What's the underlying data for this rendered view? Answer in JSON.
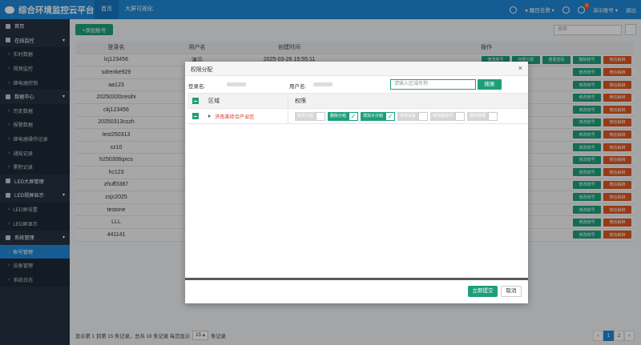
{
  "app": {
    "title": "综合环境监控云平台"
  },
  "topnav": [
    {
      "label": "首页"
    },
    {
      "label": "大屏可视化"
    }
  ],
  "topright": {
    "badge": "6",
    "lang": "醒目告警",
    "account": "演示账号",
    "logout": "退出"
  },
  "sidebar": {
    "items": [
      {
        "label": "首页",
        "type": "group"
      },
      {
        "label": "在线监控",
        "type": "group"
      },
      {
        "label": "实时数据",
        "type": "sub"
      },
      {
        "label": "视频监控",
        "type": "sub"
      },
      {
        "label": "继电器控制",
        "type": "sub"
      },
      {
        "label": "数据中心",
        "type": "group"
      },
      {
        "label": "历史数据",
        "type": "sub"
      },
      {
        "label": "报警数据",
        "type": "sub"
      },
      {
        "label": "继电器操作记录",
        "type": "sub"
      },
      {
        "label": "通知记录",
        "type": "sub"
      },
      {
        "label": "累积记录",
        "type": "sub"
      },
      {
        "label": "LED大屏管理",
        "type": "group"
      },
      {
        "label": "LED视屏显示",
        "type": "group"
      },
      {
        "label": "LED屏设置",
        "type": "sub"
      },
      {
        "label": "LED屏显示",
        "type": "sub"
      },
      {
        "label": "系统管理",
        "type": "group"
      },
      {
        "label": "账号管理",
        "type": "sub",
        "active": true
      },
      {
        "label": "设备管理",
        "type": "sub"
      },
      {
        "label": "系统日志",
        "type": "sub"
      }
    ]
  },
  "main": {
    "add_label": "+添加账号",
    "search_placeholder": "搜索",
    "table": {
      "headers": [
        "登录名",
        "用户名",
        "创建时间",
        "操作"
      ],
      "first_row_user": "演示",
      "first_row_time": "2025-03-26 15:55:11",
      "ops": [
        "修改账号",
        "权限分配",
        "重置密码",
        "删除账号",
        "微信解绑"
      ],
      "op_green": "修改账号",
      "op_orange": "微信解绑",
      "rows": [
        "lcj123456",
        "sdrenke929",
        "aa123",
        "20250320cesihi",
        "ckj123456",
        "20250313cszh",
        "test250313",
        "xz10",
        "h250306qxcs",
        "hc123",
        "zhuff3387",
        "zsjc2025",
        "testone",
        "LLL",
        "441141"
      ]
    },
    "footer": {
      "text": "显示第 1 到第 15 条记录，总共 18 条记录 每页显示",
      "page_size": "15",
      "suffix": "条记录",
      "pages": [
        "‹",
        "1",
        "2",
        "›"
      ]
    }
  },
  "modal": {
    "title": "权限分配",
    "close": "×",
    "login_label": "登录名:",
    "user_label": "用户名:",
    "area_placeholder": "请输入区域名称",
    "search_label": "搜索",
    "col_region": "区域",
    "col_perm": "权限",
    "region": "济南某综合产业区",
    "perms": [
      {
        "label": "修改分组",
        "on": false
      },
      {
        "label": "删除分组",
        "on": true
      },
      {
        "label": "增加子分组",
        "on": true
      },
      {
        "label": "修改设备",
        "on": false
      },
      {
        "label": "继电器操作",
        "on": false
      },
      {
        "label": "删除数据",
        "on": false
      }
    ],
    "submit": "立即提交",
    "cancel": "取消"
  },
  "colors": {
    "primary": "#1e88d8",
    "accent": "#1e9f7a",
    "danger": "#e0561f",
    "sidebar": "#253342"
  }
}
